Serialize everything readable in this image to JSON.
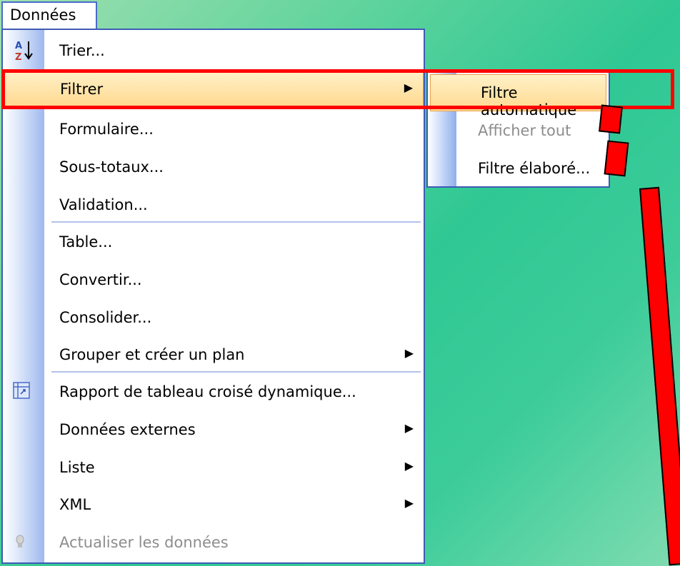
{
  "menubar": {
    "title": "Données"
  },
  "menu": {
    "items": [
      {
        "label": "Trier...",
        "icon": "sort-az-icon"
      },
      {
        "label": "Filtrer",
        "has_submenu": true,
        "highlighted": true
      },
      {
        "label": "Formulaire..."
      },
      {
        "label": "Sous-totaux..."
      },
      {
        "label": "Validation..."
      },
      {
        "label": "Table..."
      },
      {
        "label": "Convertir..."
      },
      {
        "label": "Consolider..."
      },
      {
        "label": "Grouper et créer un plan",
        "has_submenu": true
      },
      {
        "label": "Rapport de tableau croisé dynamique...",
        "icon": "pivot-table-icon"
      },
      {
        "label": "Données externes",
        "has_submenu": true
      },
      {
        "label": "Liste",
        "has_submenu": true
      },
      {
        "label": "XML",
        "has_submenu": true
      },
      {
        "label": "Actualiser les données",
        "icon": "refresh-bulb-icon",
        "disabled": true
      }
    ]
  },
  "submenu": {
    "items": [
      {
        "label": "Filtre automatique",
        "highlighted": true
      },
      {
        "label": "Afficher tout",
        "disabled": true
      },
      {
        "label": "Filtre élaboré..."
      }
    ]
  },
  "colors": {
    "highlight": "#ffd98f",
    "menu_border": "#3f5bb5",
    "callout": "#ff0000"
  }
}
